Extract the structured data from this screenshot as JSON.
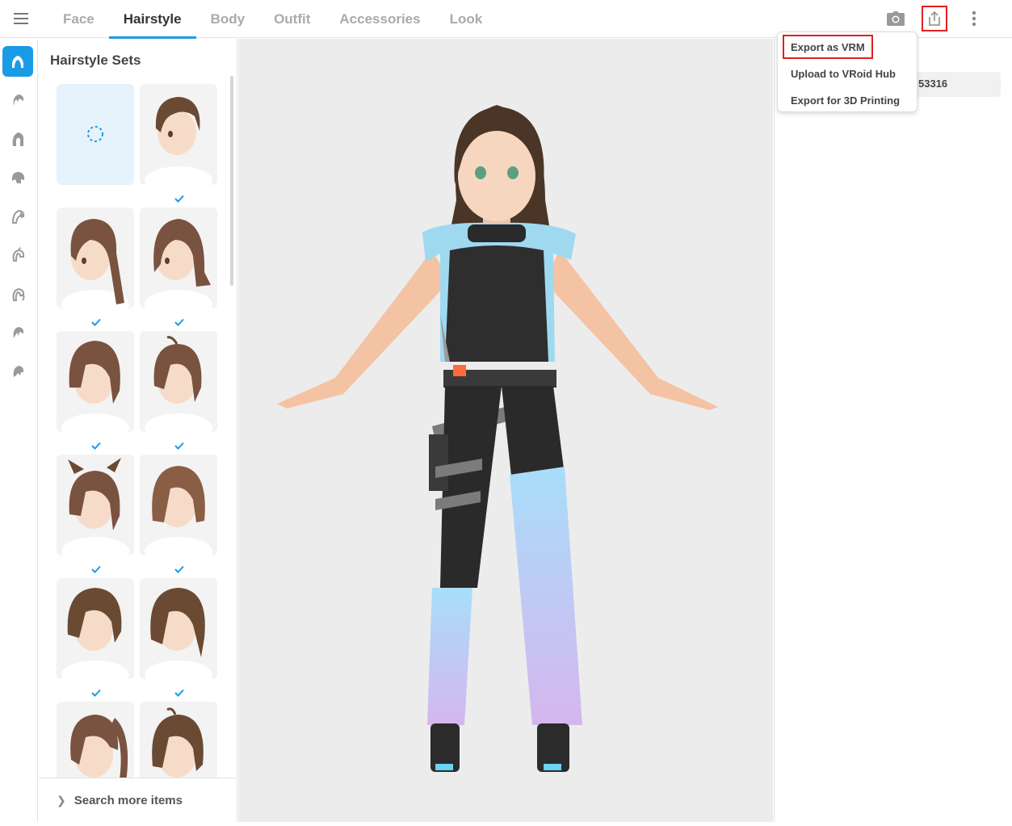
{
  "header": {
    "tabs": [
      {
        "label": "Face"
      },
      {
        "label": "Hairstyle"
      },
      {
        "label": "Body"
      },
      {
        "label": "Outfit"
      },
      {
        "label": "Accessories"
      },
      {
        "label": "Look"
      }
    ],
    "active_tab": "Hairstyle",
    "icons": [
      "menu-icon",
      "camera-icon",
      "share-export-icon",
      "more-vertical-icon"
    ]
  },
  "rail": {
    "icons": [
      "hairstyle-sets-icon",
      "front-hair-icon",
      "back-hair-icon",
      "base-hair-icon",
      "side-hair-icon",
      "ahoge-icon",
      "ponytail-icon",
      "bangs-icon",
      "hair-extra-icon"
    ],
    "active_index": 0
  },
  "panel": {
    "title": "Hairstyle Sets",
    "items": [
      {
        "name": "none",
        "selected": false,
        "checked": false
      },
      {
        "name": "short-boy",
        "selected": false,
        "checked": true
      },
      {
        "name": "long-straight",
        "selected": false,
        "checked": true
      },
      {
        "name": "bob-long",
        "selected": false,
        "checked": true
      },
      {
        "name": "shaggy-short",
        "selected": false,
        "checked": true
      },
      {
        "name": "short-ahoge",
        "selected": false,
        "checked": true
      },
      {
        "name": "cat-ears",
        "selected": false,
        "checked": true
      },
      {
        "name": "bob",
        "selected": false,
        "checked": true
      },
      {
        "name": "messy-short",
        "selected": false,
        "checked": true
      },
      {
        "name": "wolf-cut",
        "selected": false,
        "checked": true
      },
      {
        "name": "ponytail",
        "selected": false,
        "checked": false
      },
      {
        "name": "tied-short",
        "selected": false,
        "checked": false
      }
    ],
    "search_more_label": "Search more items"
  },
  "rightpanel": {
    "id_value": "53316"
  },
  "export_menu": {
    "items": [
      {
        "label": "Export as VRM",
        "highlighted": true
      },
      {
        "label": "Upload to VRoid Hub",
        "highlighted": false
      },
      {
        "label": "Export for 3D Printing",
        "highlighted": false
      }
    ]
  },
  "colors": {
    "accent": "#1a9be6",
    "highlight_box": "#e02020",
    "hair_brown": "#6b4a34",
    "viewport_bg": "#ececec"
  }
}
